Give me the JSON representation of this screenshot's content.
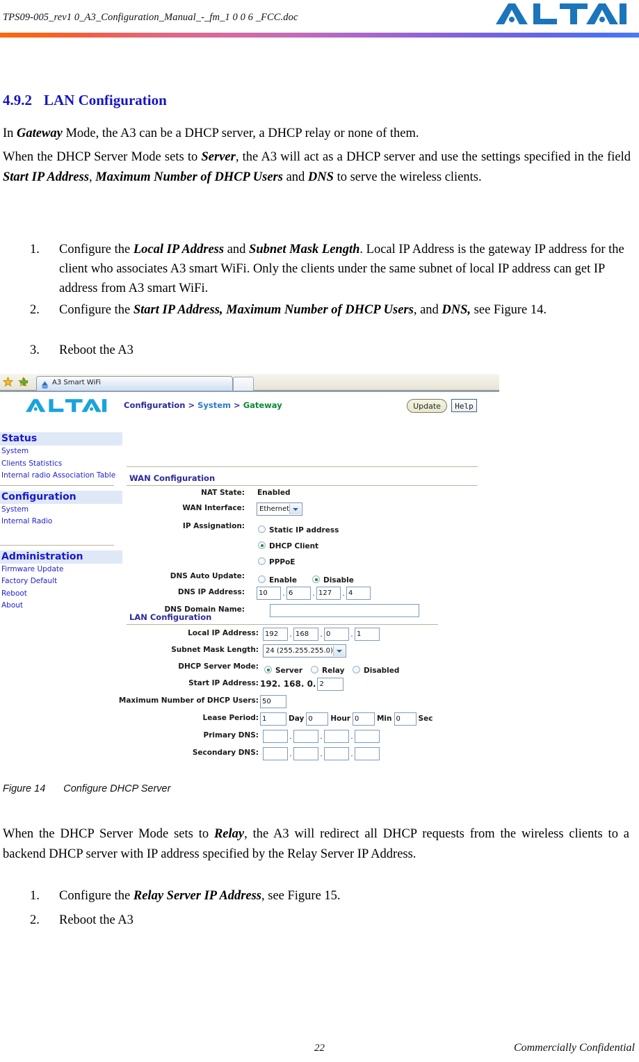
{
  "document": {
    "header_filename": "TPS09-005_rev1 0_A3_Configuration_Manual_-_fm_1 0 0 6 _FCC.doc",
    "brand": "ALTAI",
    "page_number": "22",
    "footer_confidential": "Commercially Confidential"
  },
  "section": {
    "number": "4.9.2",
    "title": "LAN Configuration",
    "paragraph_gateway_pre": "In ",
    "paragraph_gateway_em": "Gateway",
    "paragraph_gateway_post": " Mode, the A3 can be a DHCP server, a DHCP relay or none of them.",
    "paragraph_server": {
      "p1": "When the DHCP Server Mode sets to ",
      "em1": "Server",
      "p2": ", the A3 will act as a DHCP server and use the settings specified in the field ",
      "em2": "Start IP Address",
      "p3": ", ",
      "em3": "Maximum Number of DHCP Users",
      "p4": " and ",
      "em4": "DNS",
      "p5": " to serve the wireless clients."
    }
  },
  "steps_server": [
    {
      "num": "1.",
      "p1": "Configure the ",
      "em1": "Local IP Address",
      "p2": " and ",
      "em2": "Subnet Mask Length",
      "p3": ". Local IP Address is the gateway IP address for the client who associates A3 smart WiFi. Only the clients under the same subnet of local IP address can get IP address from A3 smart WiFi."
    },
    {
      "num": "2.",
      "p1": "Configure the ",
      "em1": "Start IP Address, Maximum Number of DHCP Users",
      "p2": ", and ",
      "em2": "DNS,",
      "p3": " see Figure 14."
    },
    {
      "num": "3.",
      "p1": "Reboot the A3",
      "em1": "",
      "p2": "",
      "em2": "",
      "p3": ""
    }
  ],
  "figure": {
    "label": "Figure 14",
    "caption": "Configure DHCP Server"
  },
  "paragraph_relay": {
    "p1": "When the DHCP Server Mode sets to ",
    "em1": "Relay",
    "p2": ", the A3 will redirect all DHCP requests from the wireless clients to a backend DHCP server with IP address specified by the Relay Server IP Address."
  },
  "steps_relay": [
    {
      "num": "1.",
      "p1": "Configure the ",
      "em1": "Relay Server IP Address",
      "p2": ", see Figure 15."
    },
    {
      "num": "2.",
      "p1": "Reboot the A3",
      "em1": "",
      "p2": ""
    }
  ],
  "screenshot": {
    "browser": {
      "tab_title": "A3 Smart WiFi",
      "favorites_icon": "star-icon",
      "add-favorite_icon": "star-add-icon"
    },
    "brand": "ALTAI",
    "breadcrumb": {
      "root": "Configuration",
      "sep": ">",
      "level2": "System",
      "level3": "Gateway"
    },
    "buttons": {
      "update": "Update",
      "help": "Help"
    },
    "sidebar": [
      {
        "group": "Status",
        "items": [
          "System",
          "Clients Statistics",
          "Internal radio Association Table"
        ]
      },
      {
        "group": "Configuration",
        "items": [
          "System",
          "Internal Radio"
        ]
      },
      {
        "group": "Administration",
        "items": [
          "Firmware Update",
          "Factory Default",
          "Reboot",
          "About"
        ]
      }
    ],
    "wan": {
      "heading": "WAN Configuration",
      "nat_state_label": "NAT State:",
      "nat_state_value": "Enabled",
      "wan_interface_label": "WAN Interface:",
      "wan_interface_value": "Ethernet",
      "ip_assignation_label": "IP Assignation:",
      "ip_assignation_options": [
        {
          "label": "Static IP address",
          "selected": false
        },
        {
          "label": "DHCP Client",
          "selected": true
        },
        {
          "label": "PPPoE",
          "selected": false
        }
      ],
      "dns_auto_update_label": "DNS Auto Update:",
      "dns_auto_update_options": [
        {
          "label": "Enable",
          "selected": false
        },
        {
          "label": "Disable",
          "selected": true
        }
      ],
      "dns_ip_label": "DNS IP Address:",
      "dns_ip_octets": [
        "10",
        "6",
        "127",
        "4"
      ],
      "dns_domain_label": "DNS Domain Name:",
      "dns_domain_value": ""
    },
    "lan": {
      "heading": "LAN Configuration",
      "local_ip_label": "Local IP Address:",
      "local_ip_octets": [
        "192",
        "168",
        "0",
        "1"
      ],
      "subnet_mask_label": "Subnet Mask Length:",
      "subnet_mask_value": "24 (255.255.255.0)",
      "dhcp_mode_label": "DHCP Server Mode:",
      "dhcp_mode_options": [
        {
          "label": "Server",
          "selected": true
        },
        {
          "label": "Relay",
          "selected": false
        },
        {
          "label": "Disabled",
          "selected": false
        }
      ],
      "start_ip_label": "Start IP Address:",
      "start_ip_prefix": "192. 168. 0.",
      "start_ip_last": "2",
      "max_users_label": "Maximum Number of DHCP Users:",
      "max_users_value": "50",
      "lease_label": "Lease Period:",
      "lease_day": "1",
      "lease_day_unit": "Day",
      "lease_hour": "0",
      "lease_hour_unit": "Hour",
      "lease_min": "0",
      "lease_min_unit": "Min",
      "lease_sec": "0",
      "lease_sec_unit": "Sec",
      "primary_dns_label": "Primary DNS:",
      "primary_dns_octets": [
        "",
        "",
        "",
        ""
      ],
      "secondary_dns_label": "Secondary DNS:",
      "secondary_dns_octets": [
        "",
        "",
        "",
        ""
      ]
    }
  },
  "colors": {
    "heading_blue": "#1414c8",
    "brand_blue": "#1b75bb",
    "sidebar_link": "#2222cc",
    "breadcrumb_green": "#0a8a33",
    "radio_on": "#1f8a2f"
  }
}
